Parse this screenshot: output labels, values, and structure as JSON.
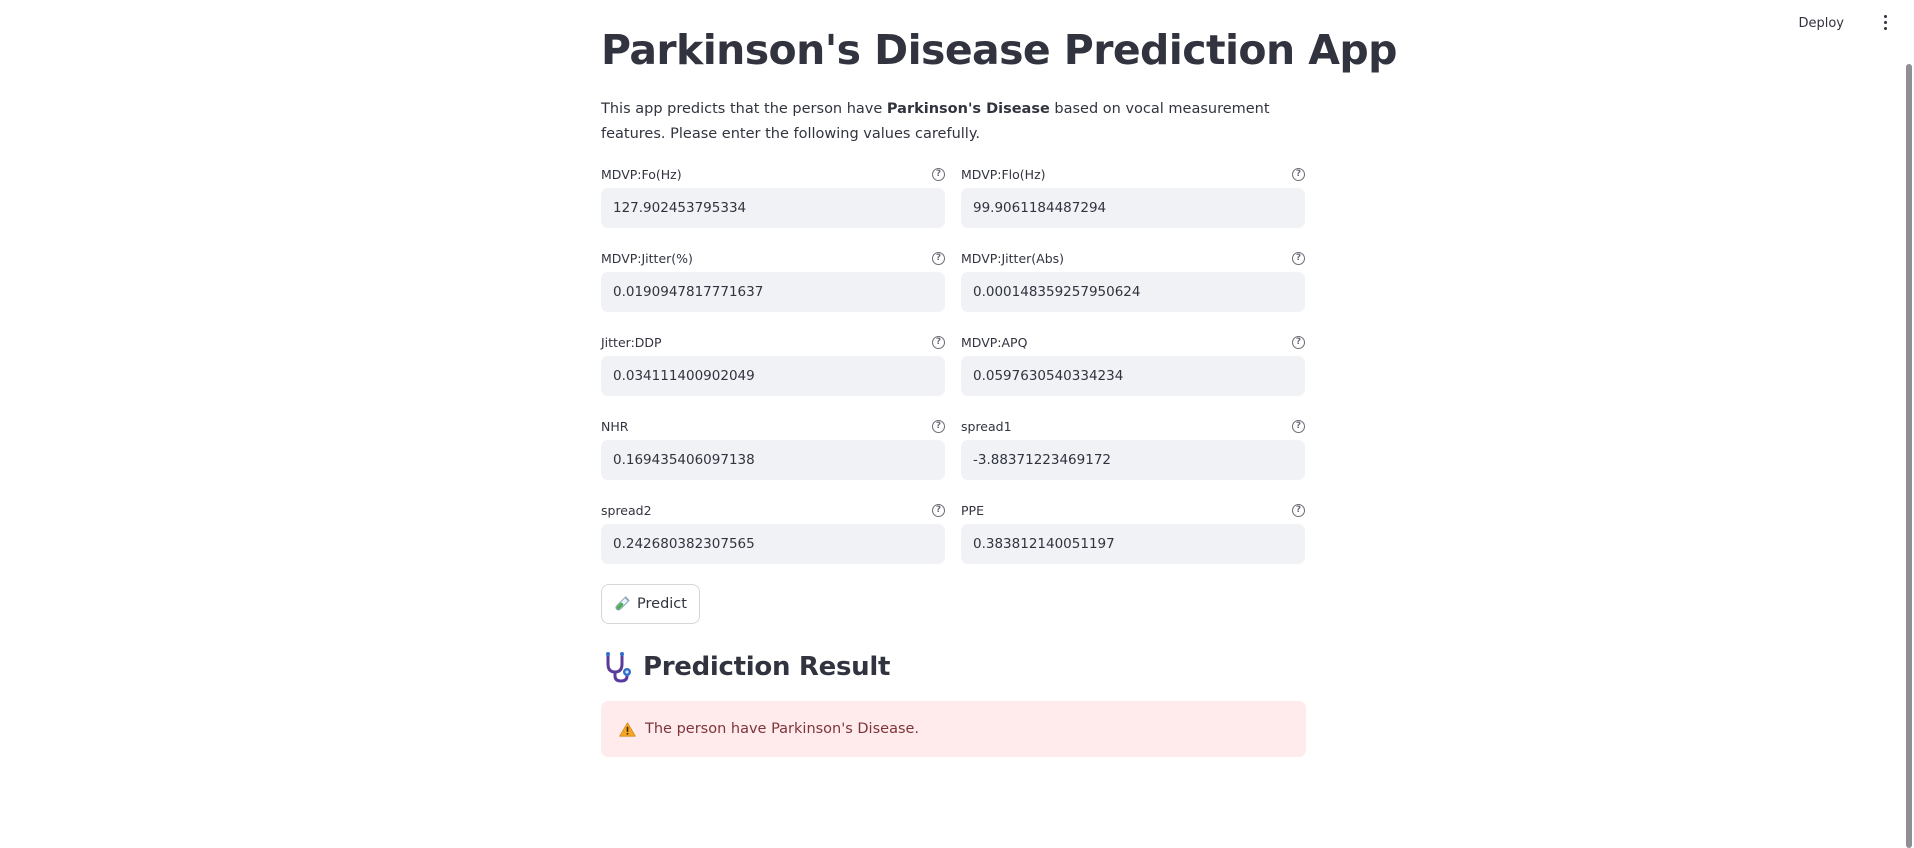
{
  "header": {
    "deploy_label": "Deploy"
  },
  "page": {
    "title": "Parkinson's Disease Prediction App",
    "intro_prefix": "This app predicts that the person have ",
    "intro_bold": "Parkinson's Disease",
    "intro_suffix": " based on vocal measurement features. Please enter the following values carefully."
  },
  "fields": [
    {
      "label": "MDVP:Fo(Hz)",
      "value": "127.902453795334"
    },
    {
      "label": "MDVP:Flo(Hz)",
      "value": "99.9061184487294"
    },
    {
      "label": "MDVP:Jitter(%)",
      "value": "0.0190947817771637"
    },
    {
      "label": "MDVP:Jitter(Abs)",
      "value": "0.000148359257950624"
    },
    {
      "label": "Jitter:DDP",
      "value": "0.034111400902049"
    },
    {
      "label": "MDVP:APQ",
      "value": "0.0597630540334234"
    },
    {
      "label": "NHR",
      "value": "0.169435406097138"
    },
    {
      "label": "spread1",
      "value": "-3.88371223469172"
    },
    {
      "label": "spread2",
      "value": "0.242680382307565"
    },
    {
      "label": "PPE",
      "value": "0.383812140051197"
    }
  ],
  "predict_button": {
    "label": "Predict",
    "icon": "test-tube-icon"
  },
  "result": {
    "heading": "Prediction Result",
    "heading_icon": "stethoscope-icon",
    "alert_icon": "warning-icon",
    "message": "The person have Parkinson's Disease."
  },
  "colors": {
    "text": "#31333f",
    "input_bg": "#f0f2f6",
    "error_bg": "#ffebeb",
    "error_text": "#7d353b"
  }
}
